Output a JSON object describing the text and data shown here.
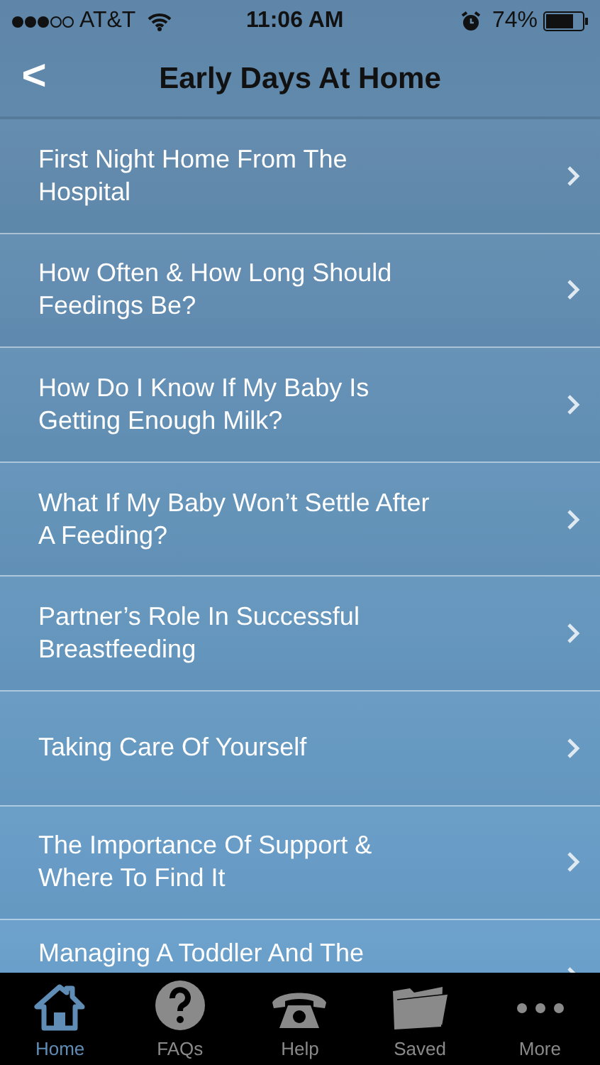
{
  "status_bar": {
    "carrier": "AT&T",
    "time": "11:06 AM",
    "battery": "74%"
  },
  "nav_bar": {
    "back": "<",
    "title": "Early Days At Home"
  },
  "items": [
    {
      "label": "First Night Home From The Hospital"
    },
    {
      "label": "How Often & How Long Should Feedings Be?"
    },
    {
      "label": "How Do I Know If My Baby Is Getting Enough Milk?"
    },
    {
      "label": "What If My Baby Won’t Settle After A Feeding?"
    },
    {
      "label": "Partner’s Role In Successful Breastfeeding"
    },
    {
      "label": "Taking Care Of Yourself"
    },
    {
      "label": "The Importance Of Support & Where To Find It"
    },
    {
      "label": "Managing A Toddler And The"
    }
  ],
  "tabs": [
    {
      "label": "Home",
      "kind": "home",
      "selected": true
    },
    {
      "label": "FAQs",
      "kind": "faq",
      "selected": false
    },
    {
      "label": "Help",
      "kind": "phone",
      "selected": false
    },
    {
      "label": "Saved",
      "kind": "folder",
      "selected": false
    },
    {
      "label": "More",
      "kind": "more",
      "selected": false
    }
  ]
}
